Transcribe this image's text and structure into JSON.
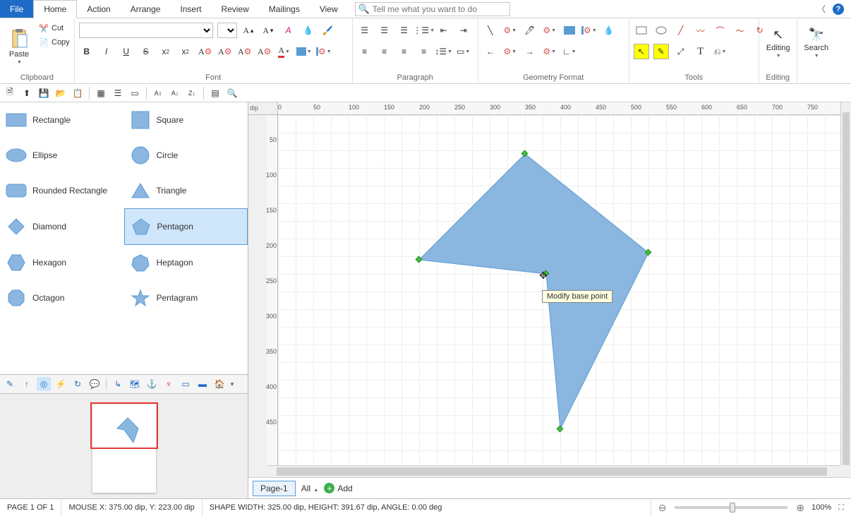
{
  "menu": {
    "file": "File",
    "tabs": [
      "Home",
      "Action",
      "Arrange",
      "Insert",
      "Review",
      "Mailings",
      "View"
    ],
    "search_placeholder": "Tell me what you want to do"
  },
  "ribbon": {
    "clipboard": {
      "label": "Clipboard",
      "paste": "Paste",
      "cut": "Cut",
      "copy": "Copy"
    },
    "font": {
      "label": "Font"
    },
    "paragraph": {
      "label": "Paragraph"
    },
    "geometry": {
      "label": "Geometry Format"
    },
    "tools": {
      "label": "Tools"
    },
    "editing": {
      "label": "Editing",
      "text": "Editing"
    },
    "search": {
      "label": "",
      "text": "Search"
    }
  },
  "shapes": [
    {
      "name": "Rectangle",
      "kind": "rect"
    },
    {
      "name": "Square",
      "kind": "square"
    },
    {
      "name": "Ellipse",
      "kind": "ellipse"
    },
    {
      "name": "Circle",
      "kind": "circle"
    },
    {
      "name": "Rounded Rectangle",
      "kind": "roundrect"
    },
    {
      "name": "Triangle",
      "kind": "triangle"
    },
    {
      "name": "Diamond",
      "kind": "diamond"
    },
    {
      "name": "Pentagon",
      "kind": "pentagon",
      "selected": true
    },
    {
      "name": "Hexagon",
      "kind": "hexagon"
    },
    {
      "name": "Heptagon",
      "kind": "heptagon"
    },
    {
      "name": "Octagon",
      "kind": "octagon"
    },
    {
      "name": "Pentagram",
      "kind": "star"
    }
  ],
  "ruler_unit": "dip",
  "ruler_x": [
    "0",
    "50",
    "100",
    "150",
    "200",
    "250",
    "300",
    "350",
    "400",
    "450",
    "500",
    "550",
    "600",
    "650",
    "700",
    "750"
  ],
  "ruler_y": [
    "50",
    "100",
    "150",
    "200",
    "250",
    "300",
    "350",
    "400",
    "450"
  ],
  "tooltip": "Modify base point",
  "page_tabs": {
    "page": "Page-1",
    "all": "All",
    "add": "Add"
  },
  "status": {
    "page": "PAGE 1 OF 1",
    "mouse": "MOUSE X: 375.00 dip, Y: 223.00 dip",
    "shape": "SHAPE WIDTH: 325.00 dip, HEIGHT: 391.67 dip, ANGLE: 0.00 deg",
    "zoom": "100%"
  },
  "colors": {
    "shape_fill": "#8ab6e0",
    "shape_stroke": "#5b9bd5",
    "accent": "#1e6cc7",
    "selection": "#e53935"
  }
}
